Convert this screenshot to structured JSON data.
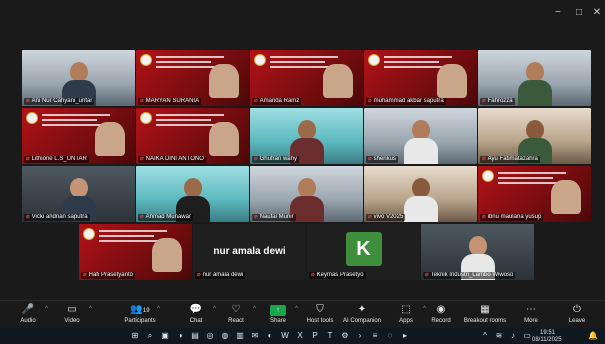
{
  "window": {
    "minimize": "−",
    "restore": "□",
    "close": "✕"
  },
  "participants": [
    {
      "name": "Ani Nur Cahyani_untar",
      "type": "room"
    },
    {
      "name": "MARYAN SURANIA",
      "type": "slide"
    },
    {
      "name": "Amanda Ramz",
      "type": "slide"
    },
    {
      "name": "muhammad akbar saputra",
      "type": "slide"
    },
    {
      "name": "Fahrozza",
      "type": "room"
    },
    {
      "name": "Lithione L.S_UNTAR",
      "type": "slide"
    },
    {
      "name": "NAIKA DINI ANTONO",
      "type": "slide"
    },
    {
      "name": "Ghufran wahy",
      "type": "room"
    },
    {
      "name": "shenkus",
      "type": "room"
    },
    {
      "name": "Ayu Fatimatazahra",
      "type": "room"
    },
    {
      "name": "Vicki andrian saputra",
      "type": "room"
    },
    {
      "name": "Ahmad Munawar",
      "type": "room"
    },
    {
      "name": "Naufal Munir",
      "type": "room"
    },
    {
      "name": "vivo V2025",
      "type": "room"
    },
    {
      "name": "ibnu maulana yusup",
      "type": "slide"
    },
    {
      "name": "Hafi Prasetyanto",
      "type": "slide"
    },
    {
      "name": "nur amala dewi",
      "type": "name",
      "bigname": "nur amala dewi"
    },
    {
      "name": "Keymas Prasetyo",
      "type": "avatar",
      "initial": "K"
    },
    {
      "name": "Teknik Industri_Lambo Wiwoso",
      "type": "photo"
    }
  ],
  "toolbar": {
    "audio": {
      "label": "Audio",
      "icon": "microphone-icon"
    },
    "video": {
      "label": "Video",
      "icon": "camera-icon"
    },
    "participants": {
      "label": "Participants",
      "count": "19",
      "icon": "people-icon"
    },
    "chat": {
      "label": "Chat",
      "icon": "chat-icon"
    },
    "react": {
      "label": "React",
      "icon": "heart-icon"
    },
    "share": {
      "label": "Share",
      "icon": "share-icon"
    },
    "host_tools": {
      "label": "Host tools",
      "icon": "shield-icon"
    },
    "ai_companion": {
      "label": "AI Companion",
      "icon": "sparkle-icon"
    },
    "apps": {
      "label": "Apps",
      "icon": "apps-icon"
    },
    "record": {
      "label": "Record",
      "icon": "record-icon"
    },
    "breakout": {
      "label": "Breakout rooms",
      "icon": "grid-icon"
    },
    "more": {
      "label": "More",
      "icon": "more-icon"
    },
    "leave": {
      "label": "Leave",
      "icon": "leave-icon"
    }
  },
  "taskbar": {
    "time": "19:51",
    "date": "08/11/2025"
  },
  "colors": {
    "slide_red": "#b31217",
    "share_green": "#1aa64b",
    "avatar_green": "#3e8e3b",
    "mic_red": "#e23a3a"
  }
}
